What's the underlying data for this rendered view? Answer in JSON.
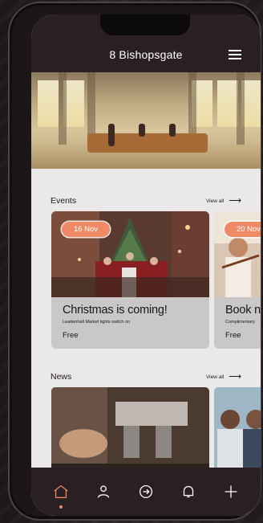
{
  "app": {
    "title": "8 Bishopsgate"
  },
  "colors": {
    "accent": "#f08a66",
    "bar": "#2a1f22",
    "surface": "#ebe8e9"
  },
  "sections": {
    "events": {
      "heading": "Events",
      "view_all": "View all"
    },
    "news": {
      "heading": "News",
      "view_all": "View all"
    }
  },
  "events": [
    {
      "date": "16 Nov",
      "title": "Christmas is coming!",
      "subtitle": "Leadenhall Market lights switch on",
      "price": "Free"
    },
    {
      "date": "20 Nov",
      "title": "Book n",
      "subtitle": "Complimentary",
      "price": "Free"
    }
  ],
  "tabs": [
    {
      "icon": "home-icon",
      "active": true
    },
    {
      "icon": "profile-icon",
      "active": false
    },
    {
      "icon": "access-icon",
      "active": false
    },
    {
      "icon": "bell-icon",
      "active": false
    },
    {
      "icon": "plus-icon",
      "active": false
    }
  ]
}
